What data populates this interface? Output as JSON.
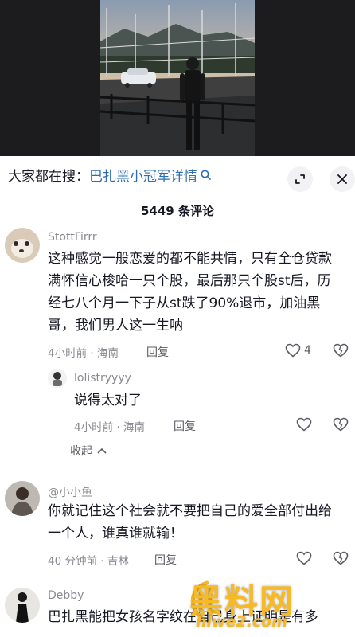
{
  "search": {
    "prefix": "大家都在搜：",
    "query": "巴扎黑小冠军详情",
    "query_icon": "search-icon"
  },
  "header_icons": [
    "expand-icon",
    "close-icon"
  ],
  "comments_count": "5449 条评论",
  "comments": [
    {
      "username": "StottFirrr",
      "text": "这种感觉一般恋爱的都不能共情，只有全仓贷款满怀信心梭哈一只个股，最后那只个股st后，历经七八个月一下子从st跌了90%退市，加油黑哥，我们男人这一生呐",
      "meta": "4小时前 · 海南",
      "reply_label": "回复",
      "likes": "4",
      "replies": [
        {
          "username": "lolistryyyy",
          "text": "说得太对了",
          "meta": "4小时前 · 海南",
          "reply_label": "回复"
        }
      ],
      "collapse_label": "收起"
    },
    {
      "username": "@小小鱼",
      "text": "你就记住这个社会就不要把自己的爱全部付出给一个人，谁真谁就输！",
      "meta": "40 分钟前 · 吉林",
      "reply_label": "回复"
    },
    {
      "username": "Debby",
      "text": "巴扎黑能把女孩名字纹在自己身上证明是有多"
    }
  ],
  "watermark": {
    "text": "黑料网",
    "url": "hlwe2.com"
  },
  "colors": {
    "link": "#2c6eb3",
    "muted": "#8a8b91",
    "watermark": "#f7b924"
  }
}
